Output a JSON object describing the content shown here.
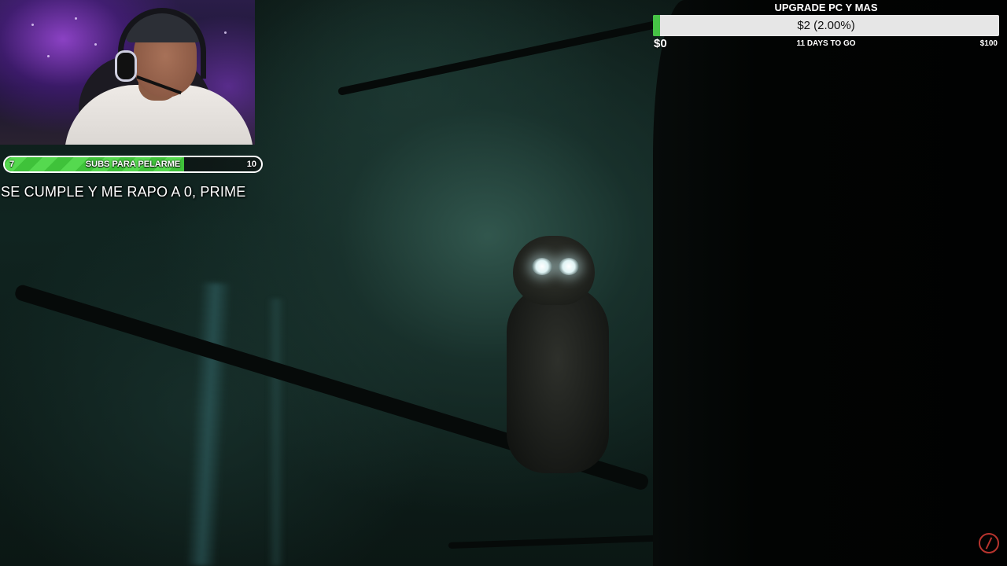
{
  "webcam": {
    "label": "streamer webcam"
  },
  "subs_goal": {
    "current": "7",
    "label": "SUBS PARA PELARME",
    "target": "10",
    "progress_fraction": 0.7,
    "fill_color": "#3fc23a"
  },
  "overlay_text": {
    "line": "SE CUMPLE Y ME RAPO A 0, PRIME"
  },
  "donation_goal": {
    "title": "UPGRADE PC Y MAS",
    "amount": "$2 (2.00%)",
    "progress_percent": 2,
    "min": "$0",
    "max": "$100",
    "days_left": "11 DAYS TO GO",
    "fill_color": "#46c346",
    "track_color": "#e6e6e6"
  },
  "scene": {
    "subject": "owl-icon",
    "logo": "streamer-logo-icon"
  },
  "colors": {
    "logo": "#b8342e",
    "text": "#ffffff"
  }
}
